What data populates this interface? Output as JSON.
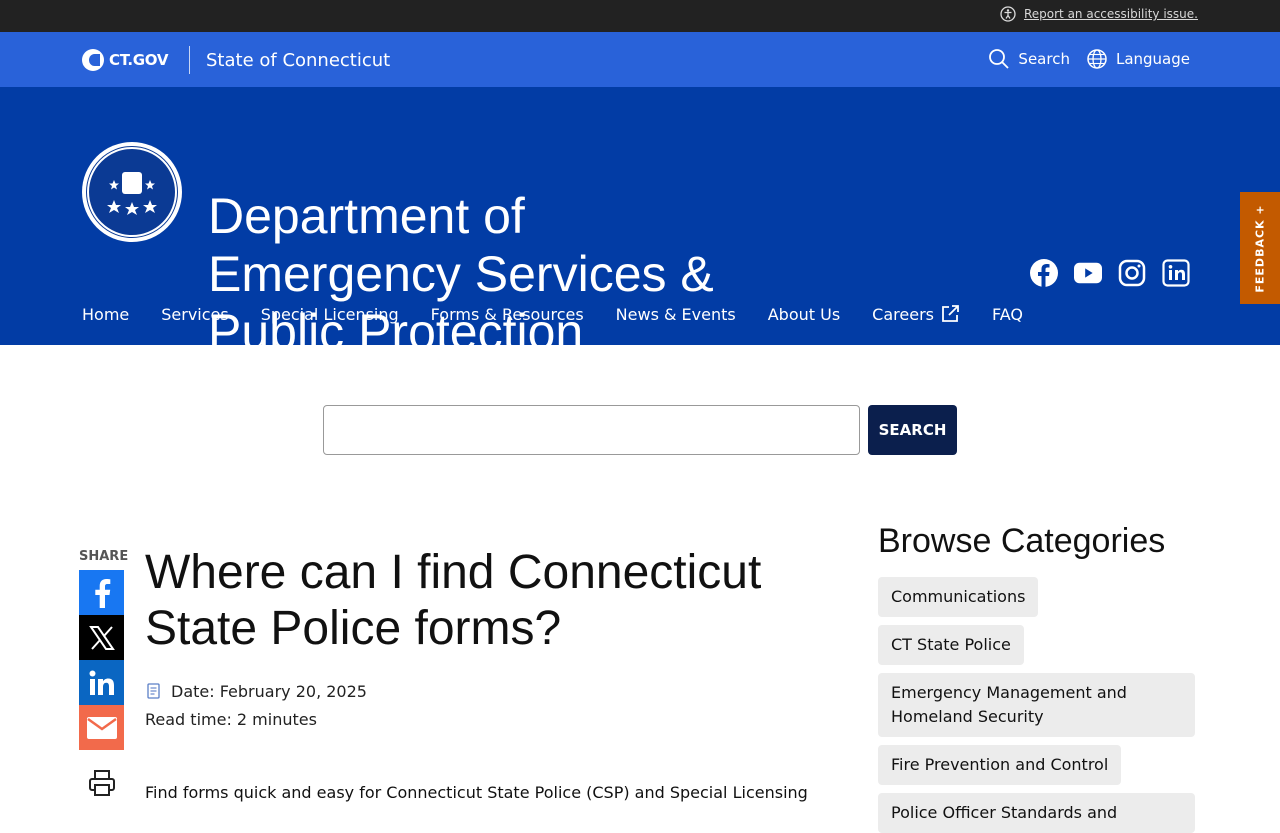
{
  "topbar": {
    "accessibility_link": "Report an accessibility issue."
  },
  "ctbar": {
    "logo_text": "CT.GOV",
    "state_name": "State of Connecticut",
    "search_label": "Search",
    "language_label": "Language"
  },
  "hero": {
    "title_line1": "Department of",
    "title_line2": "Emergency Services &",
    "title_line3": "Public Protection",
    "nav": [
      "Home",
      "Services",
      "Special Licensing",
      "Forms & Resources",
      "News & Events",
      "About Us",
      "Careers",
      "FAQ"
    ]
  },
  "feedback": {
    "label": "FEEDBACK +"
  },
  "search": {
    "button_label": "SEARCH",
    "value": ""
  },
  "share": {
    "label": "SHARE"
  },
  "article": {
    "title": "Where can I find Connecticut State Police forms?",
    "date": "Date: February 20, 2025",
    "read_time": "Read time: 2 minutes",
    "body": "Find forms quick and easy for Connecticut State Police (CSP) and Special Licensing"
  },
  "sidebar": {
    "heading": "Browse Categories",
    "categories": [
      "Communications",
      "CT State Police",
      "Emergency Management and Homeland Security",
      "Fire Prevention and Control",
      "Police Officer Standards and"
    ]
  },
  "colors": {
    "topbar": "#222222",
    "ctbar": "#2962d9",
    "hero": "#023ca5",
    "feedback": "#c35a00",
    "search_button": "#0b1f4d"
  }
}
